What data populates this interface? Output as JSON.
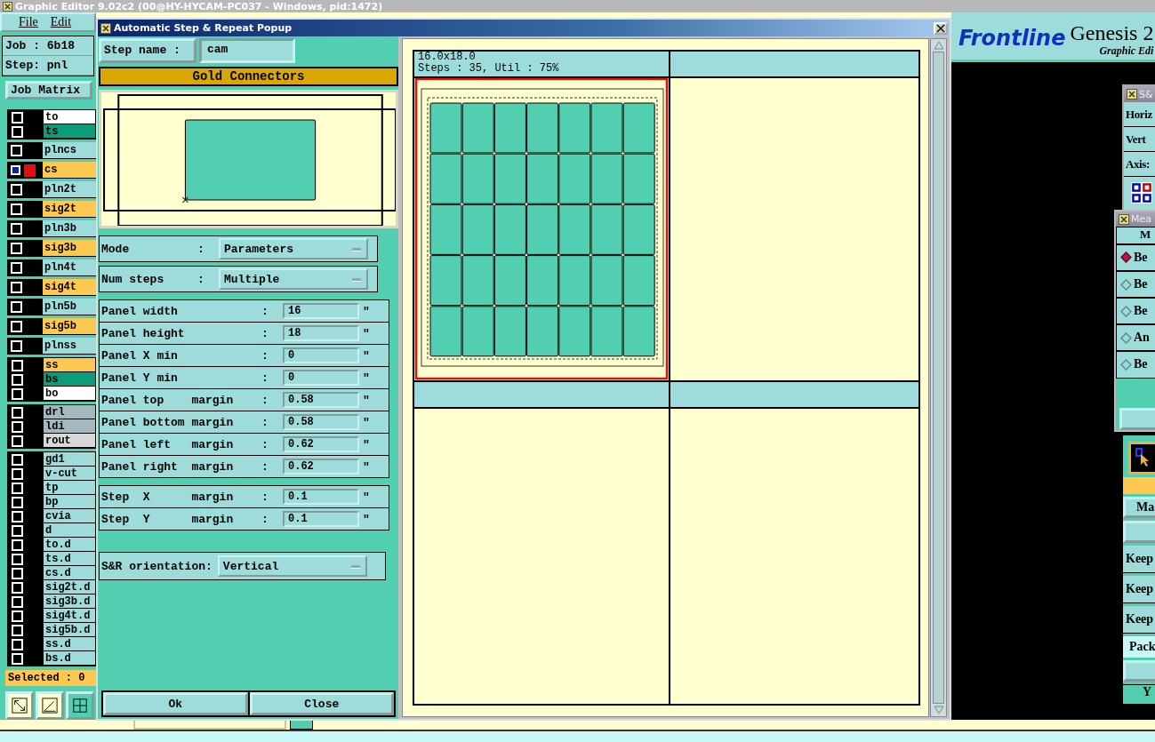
{
  "main_window": {
    "title": "Graphic Editor 9.02c2 (00@HY-HYCAM-PC037 - Windows, pid:1472)",
    "menu": [
      "File",
      "Edit"
    ],
    "job": "Job : 6b18",
    "step": "Step: pnl",
    "job_matrix_button": "Job Matrix",
    "layer_groups": [
      {
        "layers": [
          {
            "name": "to",
            "color": "#ffffff",
            "selected": false
          },
          {
            "name": "ts",
            "color": "#0c9c7c",
            "selected": false
          }
        ]
      },
      {
        "layers": [
          {
            "name": "plncs",
            "color": "#9edcdc",
            "selected": false
          },
          {
            "name": "cs",
            "color": "#ffc850",
            "selected": true
          },
          {
            "name": "pln2t",
            "color": "#9edcdc",
            "selected": false
          },
          {
            "name": "sig2t",
            "color": "#ffc850",
            "selected": false
          },
          {
            "name": "pln3b",
            "color": "#9edcdc",
            "selected": false
          },
          {
            "name": "sig3b",
            "color": "#ffc850",
            "selected": false
          },
          {
            "name": "pln4t",
            "color": "#9edcdc",
            "selected": false
          },
          {
            "name": "sig4t",
            "color": "#ffc850",
            "selected": false
          },
          {
            "name": "pln5b",
            "color": "#9edcdc",
            "selected": false
          },
          {
            "name": "sig5b",
            "color": "#ffc850",
            "selected": false
          },
          {
            "name": "plnss",
            "color": "#9edcdc",
            "selected": false
          }
        ]
      },
      {
        "layers": [
          {
            "name": "ss",
            "color": "#ffc850",
            "selected": false
          },
          {
            "name": "bs",
            "color": "#0c9c7c",
            "selected": false
          },
          {
            "name": "bo",
            "color": "#ffffff",
            "selected": false
          }
        ]
      },
      {
        "layers": [
          {
            "name": "drl",
            "color": "#a4b8c0",
            "selected": false
          },
          {
            "name": "ldi",
            "color": "#a4b8c0",
            "selected": false
          },
          {
            "name": "rout",
            "color": "#d8d8d8",
            "selected": false
          }
        ]
      },
      {
        "layers": [
          {
            "name": "gd1",
            "color": "#9edcdc",
            "selected": false
          },
          {
            "name": "v-cut",
            "color": "#9edcdc",
            "selected": false
          },
          {
            "name": "tp",
            "color": "#9edcdc",
            "selected": false
          },
          {
            "name": "bp",
            "color": "#9edcdc",
            "selected": false
          },
          {
            "name": "cvia",
            "color": "#9edcdc",
            "selected": false
          },
          {
            "name": "d",
            "color": "#9edcdc",
            "selected": false
          },
          {
            "name": "to.d",
            "color": "#9edcdc",
            "selected": false
          },
          {
            "name": "ts.d",
            "color": "#9edcdc",
            "selected": false
          },
          {
            "name": "cs.d",
            "color": "#9edcdc",
            "selected": false
          },
          {
            "name": "sig2t.d",
            "color": "#9edcdc",
            "selected": false
          },
          {
            "name": "sig3b.d",
            "color": "#9edcdc",
            "selected": false
          },
          {
            "name": "sig4t.d",
            "color": "#9edcdc",
            "selected": false
          },
          {
            "name": "sig5b.d",
            "color": "#9edcdc",
            "selected": false
          },
          {
            "name": "ss.d",
            "color": "#9edcdc",
            "selected": false
          },
          {
            "name": "bs.d",
            "color": "#9edcdc",
            "selected": false
          }
        ]
      }
    ],
    "selected_count": "Selected : 0",
    "logo": "Frontline",
    "product": "Genesis 2",
    "subtitle": "Graphic Edi"
  },
  "popup": {
    "title": "Automatic Step & Repeat Popup",
    "step_name_label": "Step name :",
    "step_name": "cam",
    "banner": "Gold Connectors",
    "selectors": [
      {
        "label": "Mode",
        "separator": ":",
        "value": "Parameters"
      },
      {
        "label": "Num steps",
        "separator": ":",
        "value": "Multiple"
      }
    ],
    "panel_fields": [
      {
        "label": "Panel width",
        "separator": ":",
        "value": "16",
        "unit": "\""
      },
      {
        "label": "Panel height",
        "separator": ":",
        "value": "18",
        "unit": "\""
      },
      {
        "label": "Panel X min",
        "separator": ":",
        "value": "0",
        "unit": "\""
      },
      {
        "label": "Panel Y min",
        "separator": ":",
        "value": "0",
        "unit": "\""
      },
      {
        "label": "Panel top    margin",
        "separator": ":",
        "value": "0.58",
        "unit": "\""
      },
      {
        "label": "Panel bottom margin",
        "separator": ":",
        "value": "0.58",
        "unit": "\""
      },
      {
        "label": "Panel left   margin",
        "separator": ":",
        "value": "0.62",
        "unit": "\""
      },
      {
        "label": "Panel right  margin",
        "separator": ":",
        "value": "0.62",
        "unit": "\""
      }
    ],
    "step_fields": [
      {
        "label": "Step  X      margin",
        "separator": ":",
        "value": "0.1",
        "unit": "\""
      },
      {
        "label": "Step  Y      margin",
        "separator": ":",
        "value": "0.1",
        "unit": "\""
      }
    ],
    "orientation": {
      "label": "S&R orientation:",
      "value": "Vertical"
    },
    "buttons": [
      "Ok",
      "Close"
    ],
    "preview": {
      "size": "16.0x18.0",
      "stats": "Steps : 35, Util : 75%"
    }
  },
  "sr_window": {
    "title": "S&",
    "rows": [
      "Horiz",
      "Vert",
      "Axis:"
    ]
  },
  "measure_window": {
    "title": "Mea",
    "header": "M",
    "options": [
      {
        "label": "Be",
        "selected": true
      },
      {
        "label": "Be",
        "selected": false
      },
      {
        "label": "Be",
        "selected": false
      },
      {
        "label": "An",
        "selected": false
      },
      {
        "label": "Be",
        "selected": false
      }
    ]
  },
  "side_panel": {
    "button": "Ma",
    "keep_rows": [
      "Keep",
      "Keep",
      "Keep"
    ],
    "pack": "Pack",
    "footer": "Y"
  }
}
